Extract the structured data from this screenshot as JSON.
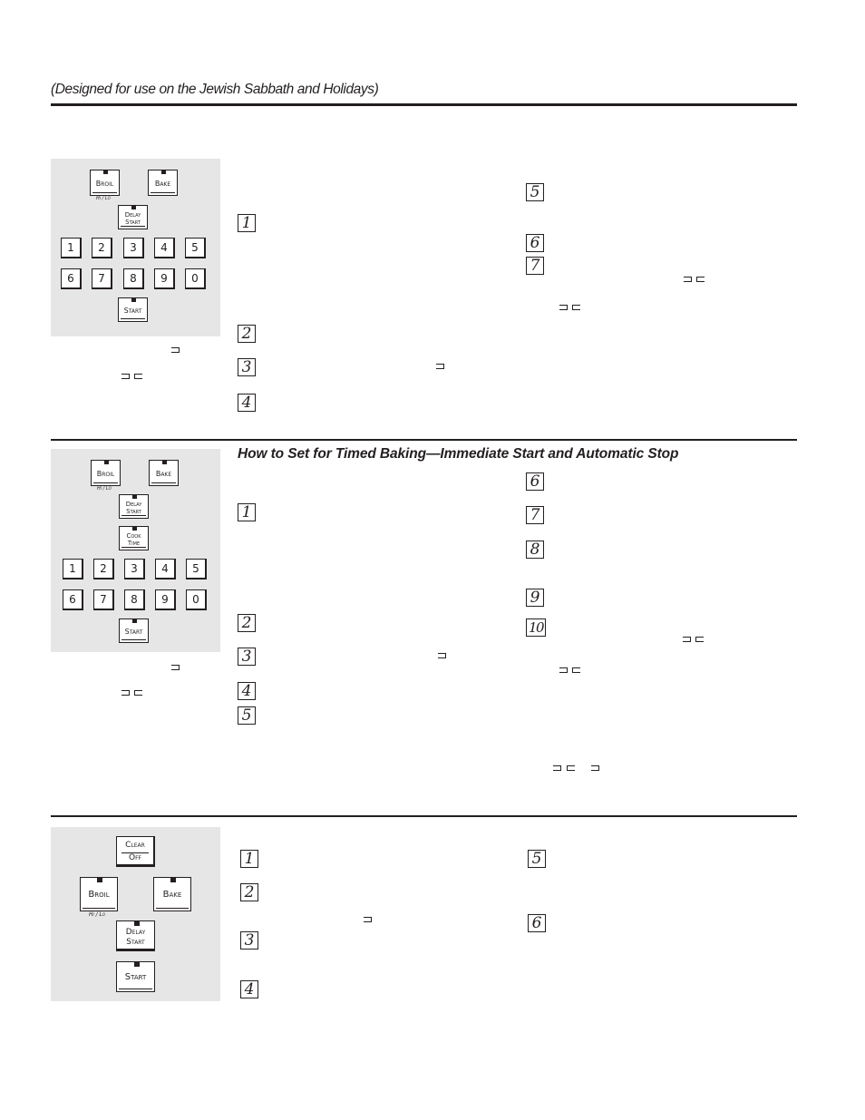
{
  "header": {
    "subtitle": "(Designed for use on the Jewish Sabbath and Holidays)"
  },
  "sections": [
    {
      "id": "section-1",
      "title": "",
      "keypad": {
        "broil": "Broil",
        "broil_sub": "Hi / Lo",
        "bake": "Bake",
        "delay_start": [
          "Delay",
          "Start"
        ],
        "digits_row1": [
          "1",
          "2",
          "3",
          "4",
          "5"
        ],
        "digits_row2": [
          "6",
          "7",
          "8",
          "9",
          "0"
        ],
        "start": "Start"
      },
      "steps_left": [
        "1",
        "2",
        "3",
        "4"
      ],
      "steps_right": [
        "5",
        "6",
        "7"
      ]
    },
    {
      "id": "section-2",
      "title": "How to Set for Timed Baking—Immediate Start and Automatic Stop",
      "keypad": {
        "broil": "Broil",
        "broil_sub": "Hi / Lo",
        "bake": "Bake",
        "delay_start": [
          "Delay",
          "Start"
        ],
        "cook_time": [
          "Cook",
          "Time"
        ],
        "digits_row1": [
          "1",
          "2",
          "3",
          "4",
          "5"
        ],
        "digits_row2": [
          "6",
          "7",
          "8",
          "9",
          "0"
        ],
        "start": "Start"
      },
      "steps_left": [
        "1",
        "2",
        "3",
        "4",
        "5"
      ],
      "steps_right": [
        "6",
        "7",
        "8",
        "9",
        "10"
      ]
    },
    {
      "id": "section-3",
      "title": "",
      "keypad": {
        "clear_off": [
          "Clear",
          "Off"
        ],
        "broil": "Broil",
        "broil_sub": "Hi / Lo",
        "bake": "Bake",
        "delay_start": [
          "Delay",
          "Start"
        ],
        "start": "Start"
      },
      "steps_left": [
        "1",
        "2",
        "3",
        "4"
      ],
      "steps_right": [
        "5",
        "6"
      ]
    }
  ]
}
